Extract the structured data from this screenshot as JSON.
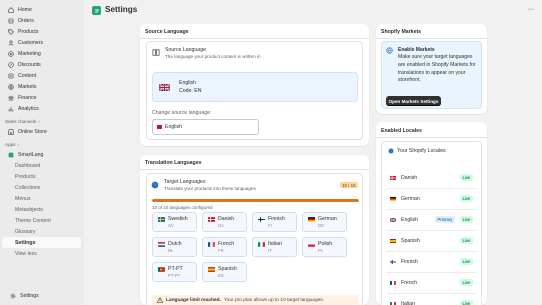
{
  "sidebar": {
    "items": [
      {
        "label": "Home",
        "icon": "home-icon"
      },
      {
        "label": "Orders",
        "icon": "orders-icon"
      },
      {
        "label": "Products",
        "icon": "tag-icon"
      },
      {
        "label": "Customers",
        "icon": "person-icon"
      },
      {
        "label": "Marketing",
        "icon": "target-icon"
      },
      {
        "label": "Discounts",
        "icon": "discount-icon"
      },
      {
        "label": "Content",
        "icon": "content-icon"
      },
      {
        "label": "Markets",
        "icon": "globe-icon"
      },
      {
        "label": "Finance",
        "icon": "bank-icon"
      },
      {
        "label": "Analytics",
        "icon": "chart-icon"
      }
    ],
    "sales_channels_label": "Sales channels",
    "online_store_label": "Online Store",
    "apps_label": "Apps",
    "app_name": "SmartLang",
    "app_subitems": [
      "Dashboard",
      "Products",
      "Collections",
      "Menus",
      "Metaobjects",
      "Theme Content",
      "Glossary",
      "Settings",
      "View less"
    ],
    "active_subitem": "Settings",
    "settings_label": "Settings"
  },
  "header": {
    "title": "Settings",
    "more_label": "···"
  },
  "source_language": {
    "title": "Source Language",
    "box_title": "Source Language",
    "box_desc": "The language your product content is written in",
    "language_name": "English",
    "language_code": "Code: EN",
    "change_label": "Change source language:",
    "select_value": "English"
  },
  "translation_languages": {
    "title": "Translation Languages",
    "box_title": "Target Languages",
    "box_desc": "Translate your products into these languages",
    "count_badge": "10 / 10",
    "configured_text": "10 of 10 languages configured",
    "progress": 1.0,
    "languages": [
      {
        "name": "Swedish",
        "code": "SV",
        "flag": "se"
      },
      {
        "name": "Danish",
        "code": "DA",
        "flag": "dk"
      },
      {
        "name": "Finnish",
        "code": "FI",
        "flag": "fi"
      },
      {
        "name": "German",
        "code": "DE",
        "flag": "de"
      },
      {
        "name": "Dutch",
        "code": "NL",
        "flag": "nl"
      },
      {
        "name": "French",
        "code": "FR",
        "flag": "fr"
      },
      {
        "name": "Italian",
        "code": "IT",
        "flag": "it"
      },
      {
        "name": "Polish",
        "code": "PL",
        "flag": "pl"
      },
      {
        "name": "PT-PT",
        "code": "PT-PT",
        "flag": "pt"
      },
      {
        "name": "Spanish",
        "code": "ES",
        "flag": "es"
      }
    ],
    "limit_title": "Language limit reached.",
    "limit_text": "Your pro plan allows up to 10 target languages."
  },
  "shopify_markets": {
    "title": "Shopify Markets",
    "box_title": "Enable Markets",
    "box_text": "Make sure your target languages are enabled in Shopify Markets for translations to appear on your storefront.",
    "button_label": "Open Markets Settings"
  },
  "enabled_locales": {
    "title": "Enabled Locales",
    "subtitle": "Your Shopify Locales",
    "locales": [
      {
        "name": "Danish",
        "flag": "dk",
        "primary": false,
        "status": "Live"
      },
      {
        "name": "German",
        "flag": "de",
        "primary": false,
        "status": "Live"
      },
      {
        "name": "English",
        "flag": "gb",
        "primary": true,
        "status": "Live"
      },
      {
        "name": "Spanish",
        "flag": "es",
        "primary": false,
        "status": "Live"
      },
      {
        "name": "Finnish",
        "flag": "fi",
        "primary": false,
        "status": "Live"
      },
      {
        "name": "French",
        "flag": "fr",
        "primary": false,
        "status": "Live"
      },
      {
        "name": "Italian",
        "flag": "it",
        "primary": false,
        "status": "Live"
      }
    ],
    "primary_label": "Primary"
  },
  "colors": {
    "accent": "#23a47a",
    "progress": "#e3701c",
    "live_badge": "#cdfee1",
    "info_bg": "#ebf4ff"
  }
}
